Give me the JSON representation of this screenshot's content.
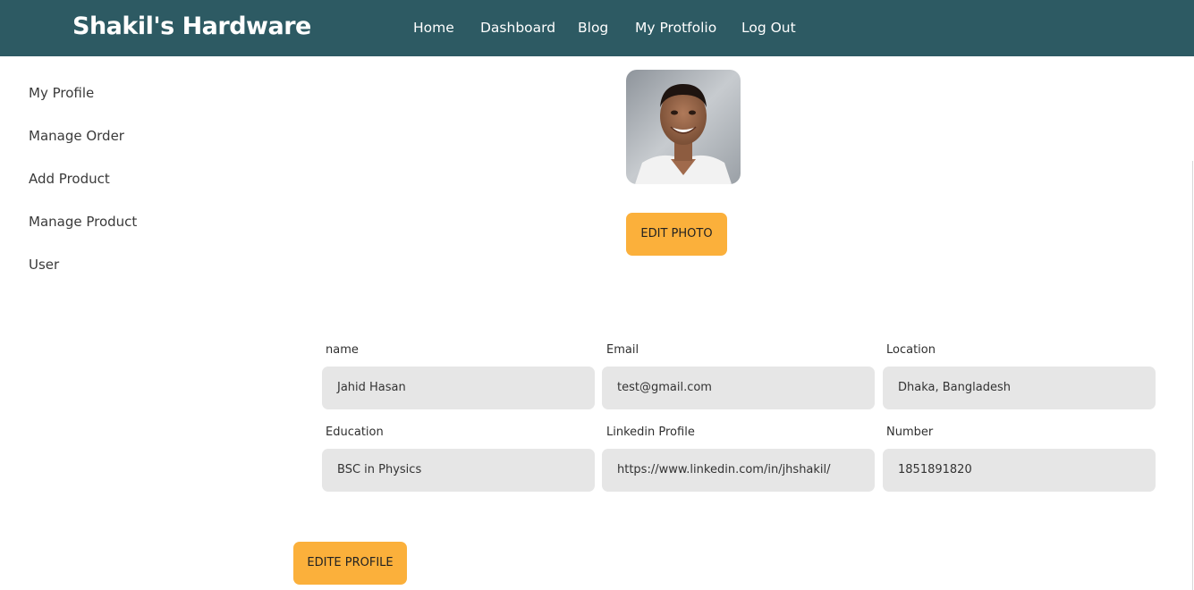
{
  "brand": "Shakil's Hardware",
  "nav": [
    "Home",
    "Dashboard",
    "Blog",
    "My Protfolio",
    "Log Out"
  ],
  "sidebar": [
    "My Profile",
    "Manage Order",
    "Add Product",
    "Manage Product",
    "User"
  ],
  "profile": {
    "edit_photo_label": "EDIT PHOTO",
    "edit_profile_label": "EDITE PROFILE",
    "fields": [
      {
        "label": "name",
        "value": "Jahid Hasan"
      },
      {
        "label": "Email",
        "value": "test@gmail.com"
      },
      {
        "label": "Location",
        "value": "Dhaka, Bangladesh"
      },
      {
        "label": "Education",
        "value": "BSC in Physics"
      },
      {
        "label": "Linkedin Profile",
        "value": "https://www.linkedin.com/in/jhshakil/"
      },
      {
        "label": "Number",
        "value": "1851891820"
      }
    ]
  },
  "colors": {
    "navbar": "#2d5a63",
    "accent": "#fbb03b",
    "field_bg": "#e6e6e6"
  }
}
